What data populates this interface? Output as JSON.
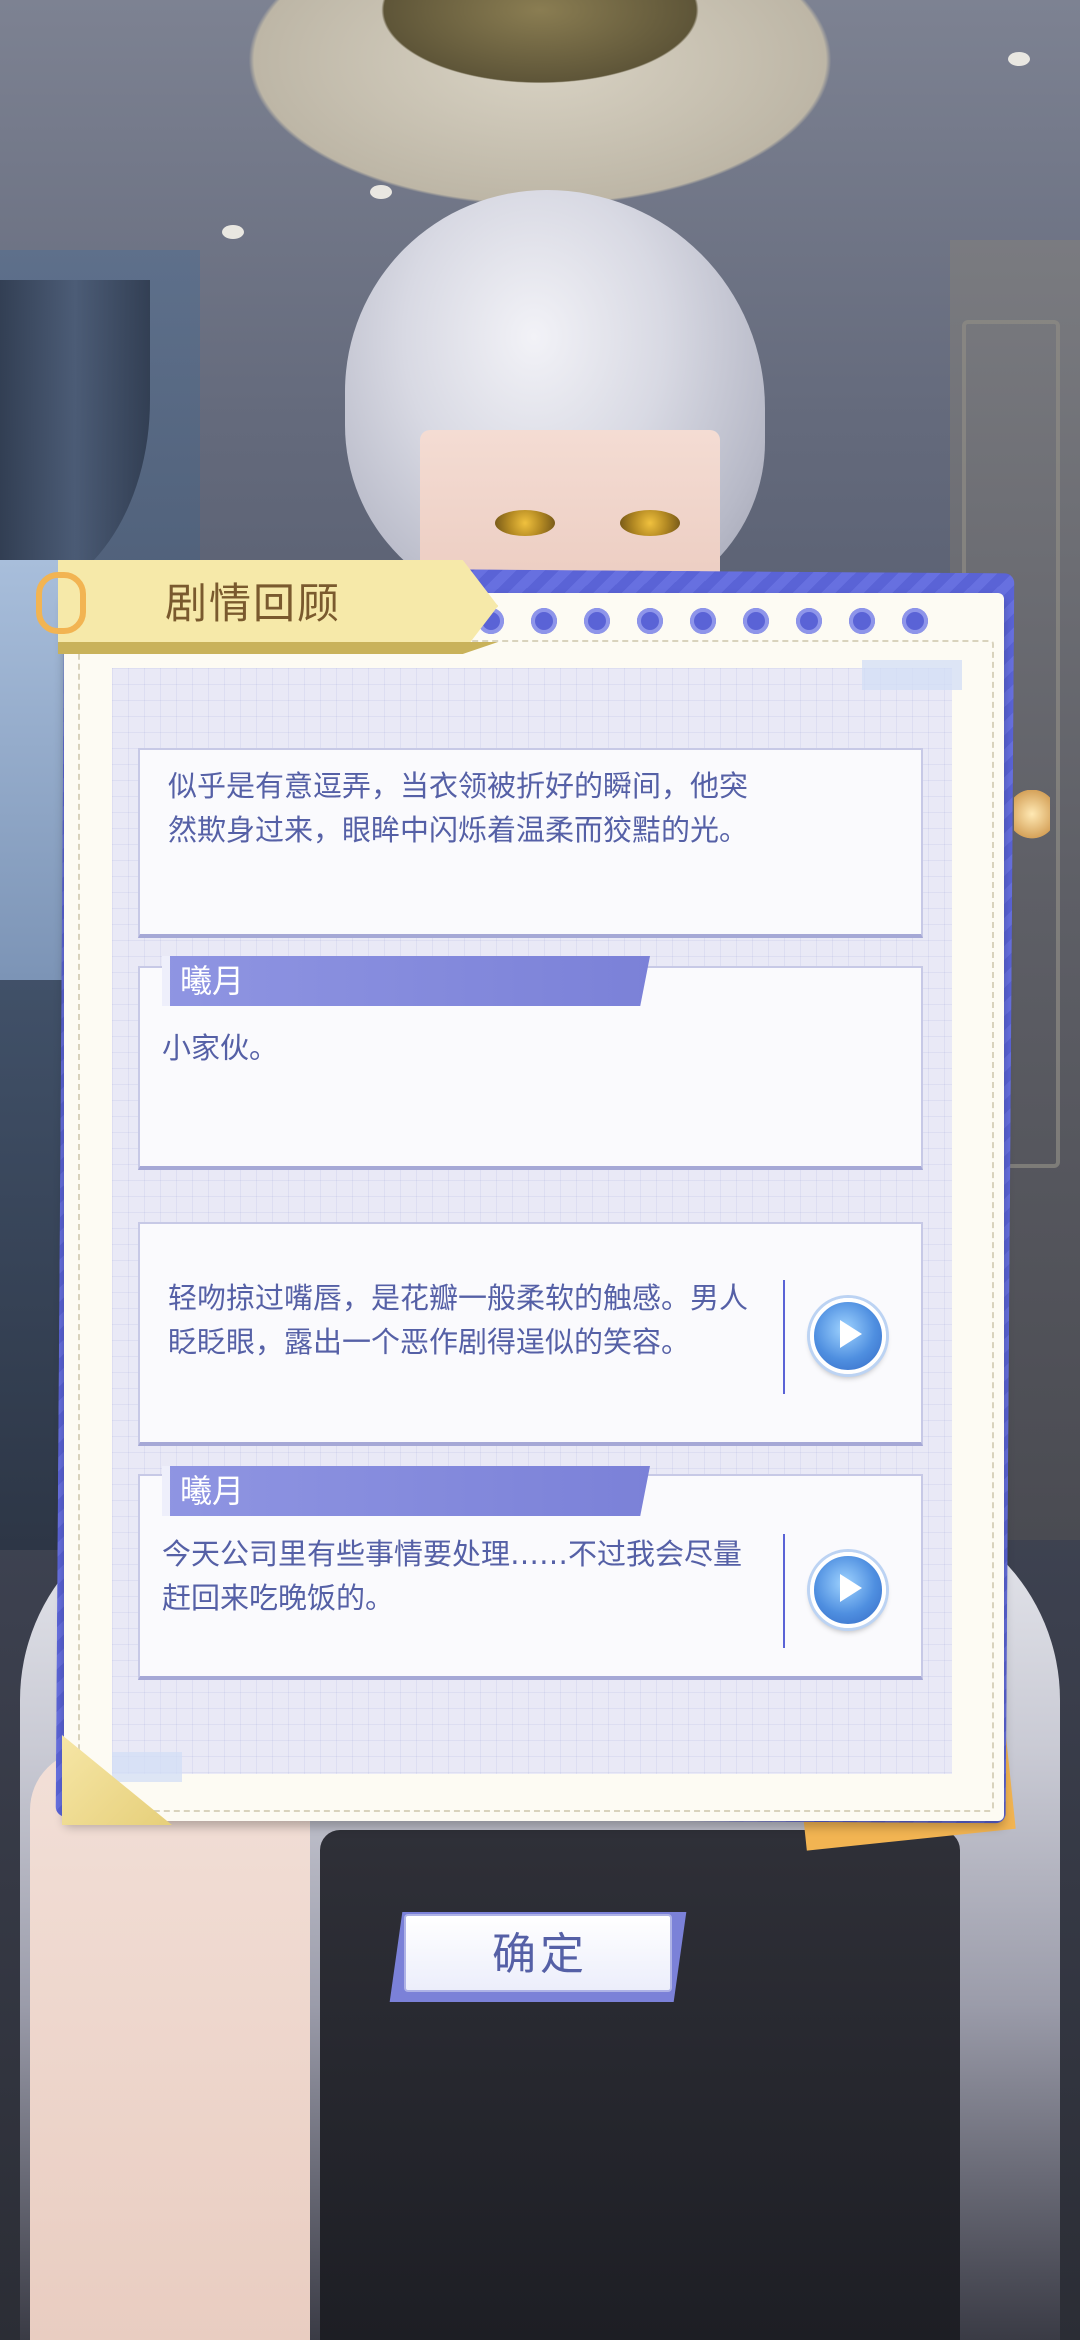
{
  "panel": {
    "title": "剧情回顾"
  },
  "entries": [
    {
      "speaker": "",
      "text": "似乎是有意逗弄，当衣领被折好的瞬间，他突然欺身过来，眼眸中闪烁着温柔而狡黠的光。",
      "has_voice": false
    },
    {
      "speaker": "曦月",
      "text": "小家伙。",
      "has_voice": false
    },
    {
      "speaker": "",
      "text": "轻吻掠过嘴唇，是花瓣一般柔软的触感。男人眨眨眼，露出一个恶作剧得逞似的笑容。",
      "has_voice": true
    },
    {
      "speaker": "曦月",
      "text": "今天公司里有些事情要处理……不过我会尽量赶回来吃晚饭的。",
      "has_voice": true
    }
  ],
  "icons": {
    "play": "play-icon",
    "clip": "paperclip-icon"
  },
  "buttons": {
    "confirm": "确定"
  },
  "colors": {
    "accent": "#5a63d6",
    "speaker_tag": "#8f95e2",
    "text": "#5560a6",
    "title_tab": "#f6e9a9",
    "paper": "#fdfbf3"
  }
}
